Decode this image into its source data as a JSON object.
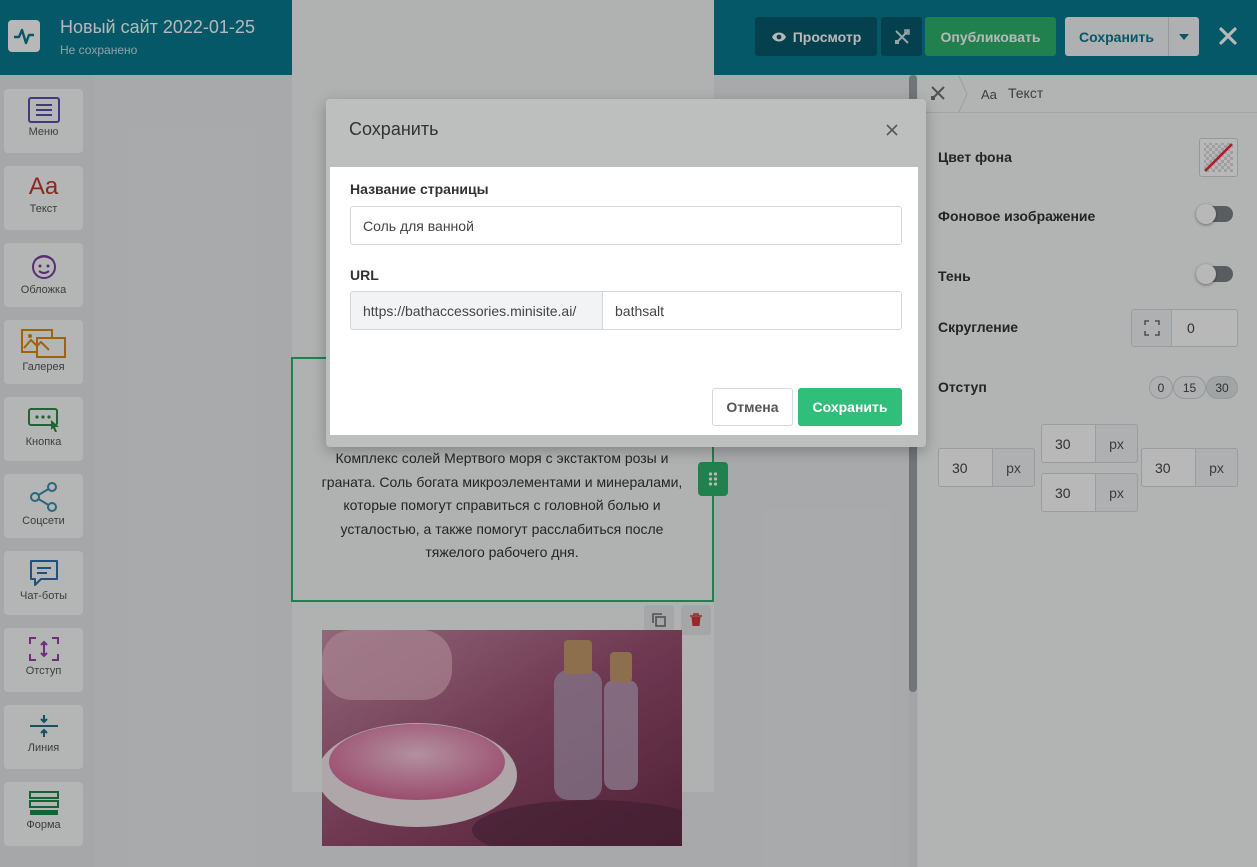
{
  "header": {
    "title": "Новый сайт 2022-01-25",
    "status": "Не сохранено",
    "preview_label": "Просмотр",
    "publish_label": "Опубликовать",
    "save_label": "Сохранить",
    "accent_color": "#087a91",
    "publish_color": "#2fb36d"
  },
  "sidebar": {
    "items": [
      {
        "label": "Меню",
        "icon": "menu-icon"
      },
      {
        "label": "Текст",
        "icon": "text-icon"
      },
      {
        "label": "Обложка",
        "icon": "cover-icon"
      },
      {
        "label": "Галерея",
        "icon": "gallery-icon"
      },
      {
        "label": "Кнопка",
        "icon": "button-icon"
      },
      {
        "label": "Соцсети",
        "icon": "share-icon"
      },
      {
        "label": "Чат-боты",
        "icon": "chat-icon"
      },
      {
        "label": "Отступ",
        "icon": "spacing-icon"
      },
      {
        "label": "Линия",
        "icon": "line-icon"
      },
      {
        "label": "Форма",
        "icon": "form-icon"
      }
    ]
  },
  "canvas": {
    "text_block": "Комплекс солей Мертвого моря с экстактом розы и граната. Соль богата микроэлементами и минералами, которые помогут справиться с головной болью и усталостью, а также помогут расслабиться после тяжелого рабочего дня."
  },
  "panel": {
    "crumb_prefix": "Aa",
    "crumb_label": "Текст",
    "bg_color_label": "Цвет фона",
    "bg_image_label": "Фоновое изображение",
    "shadow_label": "Тень",
    "radius_label": "Скругление",
    "radius_value": "0",
    "padding_label": "Отступ",
    "padding_presets": [
      "0",
      "15",
      "30"
    ],
    "padding_unit": "px",
    "padding_left": "30",
    "padding_top": "30",
    "padding_bottom": "30",
    "padding_right": "30"
  },
  "modal": {
    "title": "Сохранить",
    "page_name_label": "Название страницы",
    "page_name_value": "Соль для ванной",
    "url_label": "URL",
    "url_prefix": "https://bathaccessories.minisite.ai/",
    "url_slug": "bathsalt",
    "cancel_label": "Отмена",
    "save_label": "Сохранить",
    "save_color": "#2fbf7b"
  }
}
